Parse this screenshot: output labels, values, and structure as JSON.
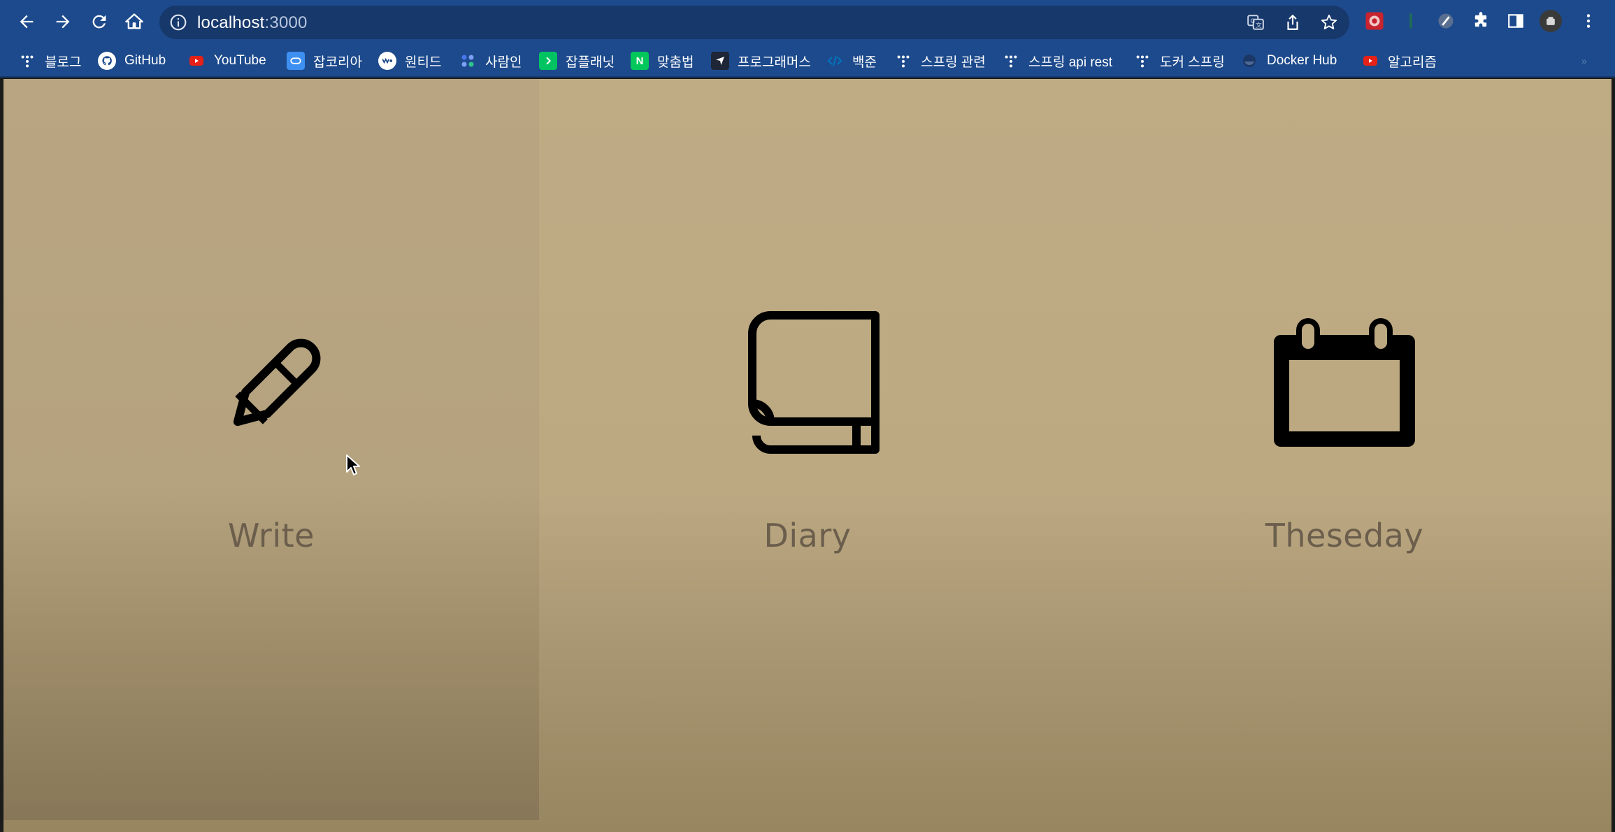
{
  "browser": {
    "url_host": "localhost",
    "url_port": ":3000",
    "nav_icons": [
      "back-icon",
      "forward-icon",
      "reload-icon",
      "home-icon"
    ],
    "omnibox_icons": [
      "translate-icon",
      "share-icon",
      "bookmark-star-icon"
    ],
    "toolbar_icons": [
      "extension-icon",
      "extension-icon",
      "extension-icon",
      "puzzle-icon",
      "side-panel-icon",
      "profile-avatar",
      "menu-kebab-icon"
    ]
  },
  "bookmarks": [
    {
      "label": "블로그",
      "icon": "tistory-icon",
      "color": "#ffffff"
    },
    {
      "label": "GitHub",
      "icon": "github-icon",
      "color": "#ffffff"
    },
    {
      "label": "YouTube",
      "icon": "youtube-icon",
      "color": "#e62117"
    },
    {
      "label": "잡코리아",
      "icon": "jobkorea-icon",
      "color": "#3d8ff2"
    },
    {
      "label": "원티드",
      "icon": "wanted-icon",
      "color": "#ffffff"
    },
    {
      "label": "사람인",
      "icon": "saramin-icon",
      "color": "#4876ef"
    },
    {
      "label": "잡플래닛",
      "icon": "jobplanet-icon",
      "color": "#00c362"
    },
    {
      "label": "맞춤법",
      "icon": "naver-icon",
      "color": "#03c75a"
    },
    {
      "label": "프로그래머스",
      "icon": "programmers-icon",
      "color": "#1e2536"
    },
    {
      "label": "백준",
      "icon": "code-icon",
      "color": "#0076c0"
    },
    {
      "label": "스프링 관련",
      "icon": "tistory-icon",
      "color": "#ffffff"
    },
    {
      "label": "스프링 api rest",
      "icon": "tistory-icon",
      "color": "#ffffff"
    },
    {
      "label": "도커 스프링",
      "icon": "tistory-icon",
      "color": "#ffffff"
    },
    {
      "label": "Docker Hub",
      "icon": "docker-icon",
      "color": "#1d63ed"
    },
    {
      "label": "알고리즘",
      "icon": "youtube-icon",
      "color": "#e62117"
    }
  ],
  "tiles": [
    {
      "label": "Write",
      "icon": "pencil-icon"
    },
    {
      "label": "Diary",
      "icon": "book-icon"
    },
    {
      "label": "Theseday",
      "icon": "calendar-icon"
    }
  ],
  "colors": {
    "chrome": "#1d4a8c",
    "page_bg": "#bfab84",
    "label": "#6b5e4c"
  }
}
